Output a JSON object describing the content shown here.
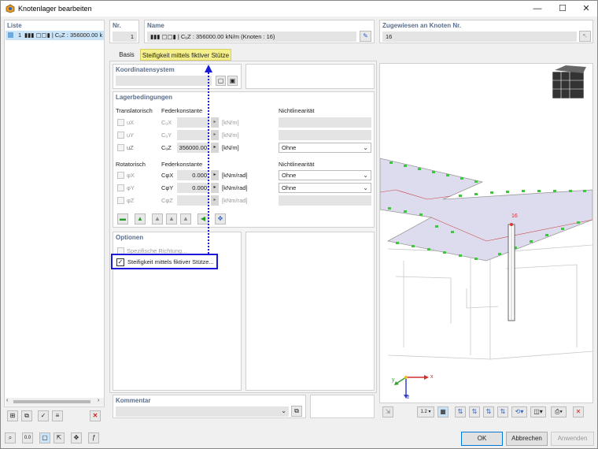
{
  "window": {
    "title": "Knotenlager bearbeiten",
    "min": "—",
    "max": "☐",
    "close": "✕"
  },
  "list": {
    "header": "Liste",
    "item_no": "1",
    "item_text": "▮▮▮ ▢▢▮ | CᵤZ : 356000.00 k"
  },
  "nr": {
    "label": "Nr.",
    "value": "1"
  },
  "name": {
    "label": "Name",
    "value": "▮▮▮ ▢▢▮ | CᵤZ : 356000.00 kN/m (Knoten : 16)"
  },
  "assigned": {
    "label": "Zugewiesen an Knoten Nr.",
    "value": "16"
  },
  "tabs": [
    {
      "label": "Basis"
    },
    {
      "label": "Steifigkeit mittels fiktiver Stütze"
    }
  ],
  "coord": {
    "header": "Koordinatensystem"
  },
  "bearing": {
    "header": "Lagerbedingungen",
    "trans_title": "Translatorisch",
    "spring_title": "Federkonstante",
    "nonlin_title": "Nichtlinearität",
    "trans_rows": [
      {
        "dof": "uX",
        "spring": "CᵤX",
        "value": "",
        "unit": "[kN/m]",
        "nonlin": "",
        "checked": false,
        "active": false
      },
      {
        "dof": "uY",
        "spring": "CᵤY",
        "value": "",
        "unit": "[kN/m]",
        "nonlin": "",
        "checked": false,
        "active": false
      },
      {
        "dof": "uZ",
        "spring": "CᵤZ",
        "value": "356000.00",
        "unit": "[kN/m]",
        "nonlin": "Ohne",
        "checked": false,
        "active": true
      }
    ],
    "rot_title": "Rotatorisch",
    "rot_spring_title": "Federkonstante",
    "rot_nonlin_title": "Nichtlinearität",
    "rot_rows": [
      {
        "dof": "φX",
        "spring": "CφX",
        "value": "0.000",
        "unit": "[kNm/rad]",
        "nonlin": "Ohne",
        "checked": false,
        "active": true
      },
      {
        "dof": "φY",
        "spring": "CφY",
        "value": "0.000",
        "unit": "[kNm/rad]",
        "nonlin": "Ohne",
        "checked": false,
        "active": true
      },
      {
        "dof": "φZ",
        "spring": "CφZ",
        "value": "",
        "unit": "[kNm/rad]",
        "nonlin": "",
        "checked": false,
        "active": false
      }
    ]
  },
  "options": {
    "header": "Optionen",
    "spec_dir": "Spezifische Richtung...",
    "fict": "Steifigkeit mittels fiktiver Stütze..."
  },
  "comment": {
    "header": "Kommentar"
  },
  "view": {
    "node_label": "16"
  },
  "axes": {
    "x": "x",
    "y": "y",
    "z": "z"
  },
  "footer": {
    "ok": "OK",
    "cancel": "Abbrechen",
    "apply": "Anwenden"
  },
  "colors": {
    "accent_yellow": "#f5f08a",
    "highlight_blue": "#1a1ad8",
    "support_green": "#3cc83c",
    "section_blue": "#5a6e8c"
  }
}
